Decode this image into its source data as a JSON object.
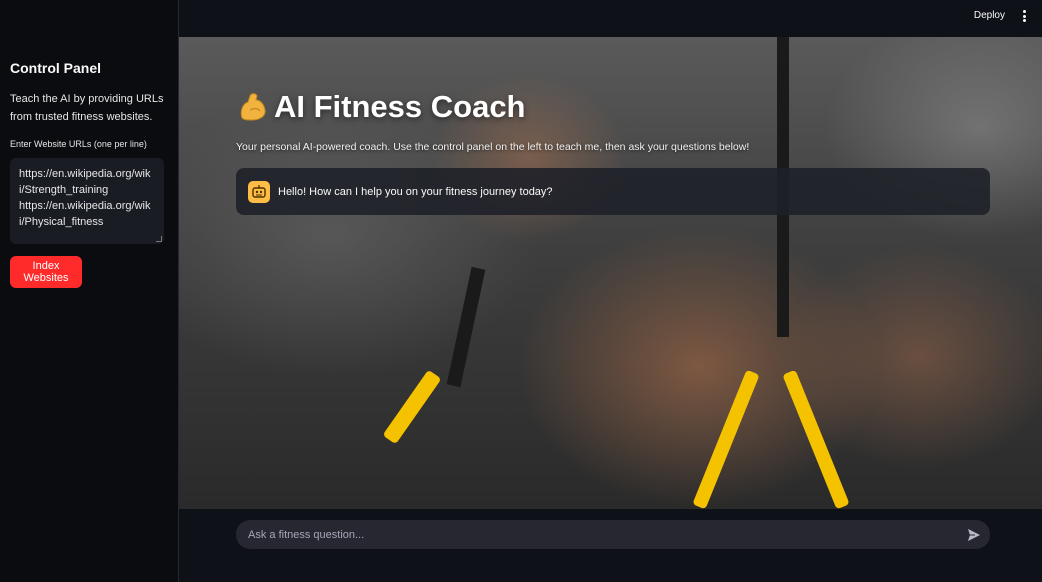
{
  "header": {
    "deploy_label": "Deploy"
  },
  "sidebar": {
    "title": "Control Panel",
    "description": "Teach the AI by providing URLs from trusted fitness websites.",
    "url_label": "Enter Website URLs (one per line)",
    "url_value": "https://en.wikipedia.org/wiki/Strength_training\nhttps://en.wikipedia.org/wiki/Physical_fitness",
    "index_button": "Index Websites"
  },
  "main": {
    "title_icon": "flexed-biceps-icon",
    "title": "AI Fitness Coach",
    "subtitle": "Your personal AI-powered coach. Use the control panel on the left to teach me, then ask your questions below!",
    "messages": [
      {
        "role": "assistant",
        "avatar": "robot-icon",
        "text": "Hello! How can I help you on your fitness journey today?"
      }
    ]
  },
  "chat_input": {
    "placeholder": "Ask a fitness question..."
  },
  "colors": {
    "accent": "#ff2b2b",
    "avatar": "#ffbd45",
    "background": "#0e1117"
  }
}
